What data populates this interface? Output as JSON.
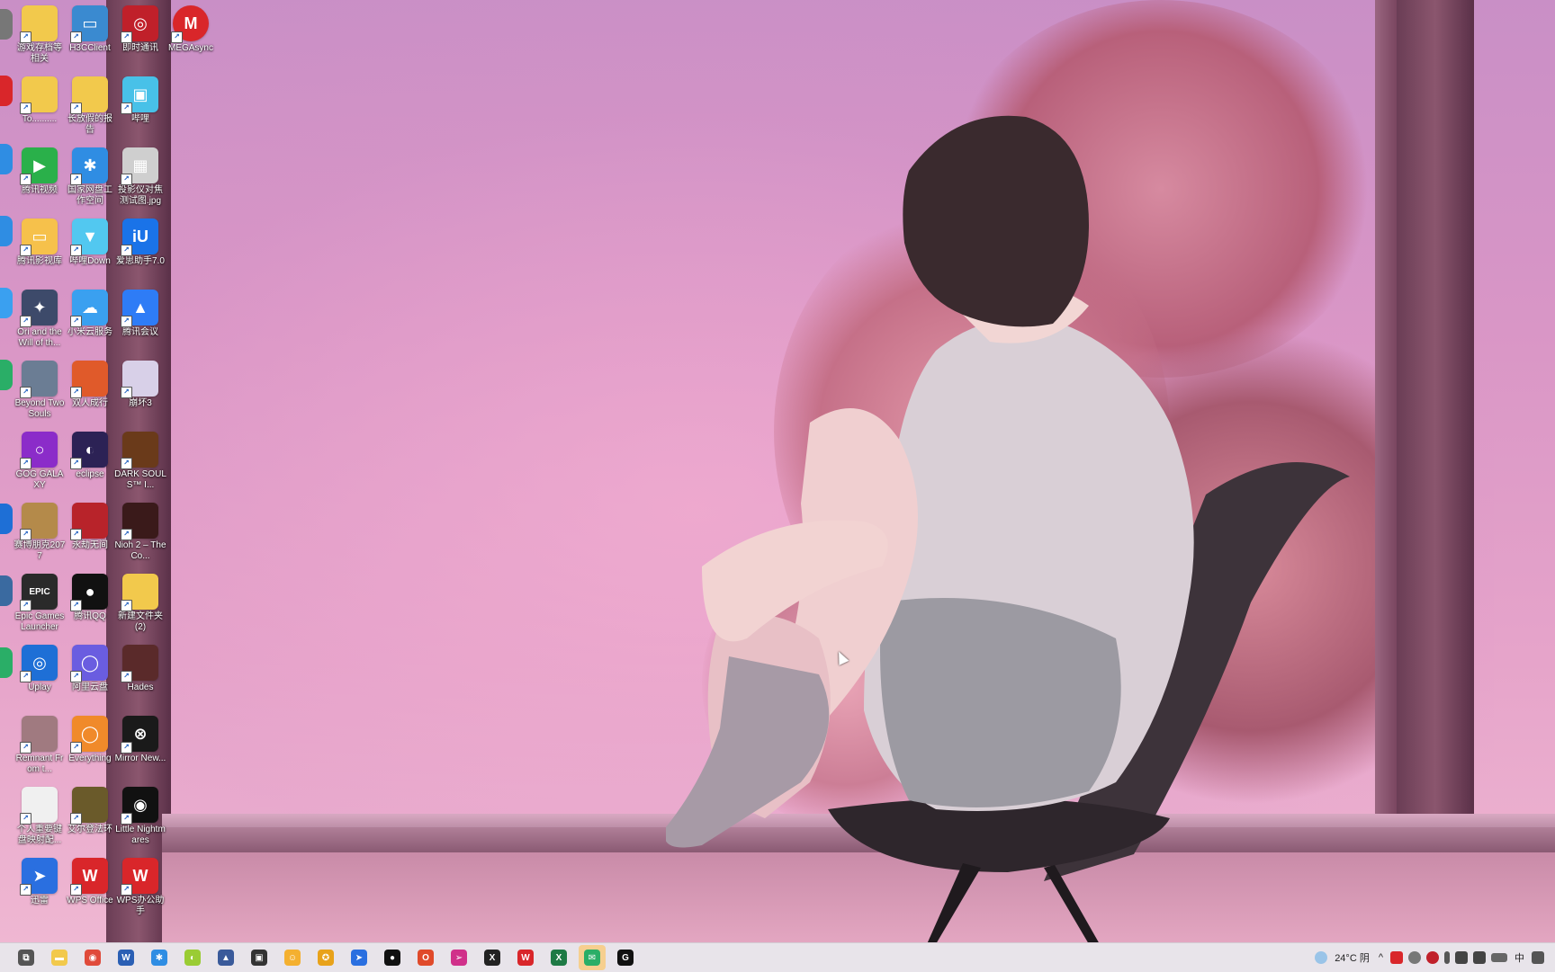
{
  "desktop": {
    "columns": [
      [
        {
          "label": "游戏存档等相关",
          "icon": "folder",
          "color": "#f2c94c"
        },
        {
          "label": "To..........",
          "icon": "folder",
          "color": "#f2c94c"
        },
        {
          "label": "腾讯视频",
          "icon": "play-icon",
          "color": "#2ab04a"
        },
        {
          "label": "腾讯影视库",
          "icon": "folder-tv",
          "color": "#f6c14b"
        },
        {
          "label": "Ori and the Will of th...",
          "icon": "ori-game",
          "color": "#3d4a6a"
        },
        {
          "label": "Beyond Two Souls",
          "icon": "game",
          "color": "#6b7d94"
        },
        {
          "label": "GOG GALAXY",
          "icon": "gog-ring",
          "color": "#8b2cc9"
        },
        {
          "label": "赛博朋克2077",
          "icon": "game",
          "color": "#b48a4a"
        },
        {
          "label": "Epic Games Launcher",
          "icon": "epic",
          "color": "#2a2a2a"
        },
        {
          "label": "Uplay",
          "icon": "uplay",
          "color": "#1e6fd6"
        },
        {
          "label": "Remnant From t...",
          "icon": "game",
          "color": "#a07a80"
        },
        {
          "label": "个人重要键盘映射配...",
          "icon": "document",
          "color": "#f0f0f0"
        },
        {
          "label": "迅雷",
          "icon": "thunder",
          "color": "#2a6fe0"
        }
      ],
      [
        {
          "label": "H3CClient",
          "icon": "h3c",
          "color": "#3a8ad0"
        },
        {
          "label": "长放假的报告",
          "icon": "folder",
          "color": "#f2c94c"
        },
        {
          "label": "国家网盘工作空间",
          "icon": "netdisk",
          "color": "#2f8de3"
        },
        {
          "label": "哔哩Down",
          "icon": "bili-down",
          "color": "#52c8f0"
        },
        {
          "label": "小米云服务",
          "icon": "cloud",
          "color": "#3aa0f0"
        },
        {
          "label": "双人成行",
          "icon": "game",
          "color": "#e05a2a"
        },
        {
          "label": "eclipse",
          "icon": "eclipse",
          "color": "#2c2255"
        },
        {
          "label": "永劫无间",
          "icon": "game",
          "color": "#b8232a"
        },
        {
          "label": "腾讯QQ",
          "icon": "qq-penguin",
          "color": "#111111"
        },
        {
          "label": "阿里云盘",
          "icon": "aliyun",
          "color": "#6a5de0"
        },
        {
          "label": "Everything",
          "icon": "search-ring",
          "color": "#f08a2a"
        },
        {
          "label": "艾尔登法环",
          "icon": "game",
          "color": "#6a5a2a"
        },
        {
          "label": "WPS Office",
          "icon": "wps",
          "color": "#d9262a"
        }
      ],
      [
        {
          "label": "即时通讯",
          "icon": "chat",
          "color": "#c0202a"
        },
        {
          "label": "哔哩",
          "icon": "bilibili",
          "color": "#48c1e8"
        },
        {
          "label": "投影仪对焦测试图.jpg",
          "icon": "image",
          "color": "#cfcfcf"
        },
        {
          "label": "爱思助手7.0",
          "icon": "iu",
          "color": "#1a73e8"
        },
        {
          "label": "腾讯会议",
          "icon": "meeting",
          "color": "#2e7cf6"
        },
        {
          "label": "崩坏3",
          "icon": "game",
          "color": "#d8d0e8"
        },
        {
          "label": "DARK SOULS™ I...",
          "icon": "game",
          "color": "#6a3a1a"
        },
        {
          "label": "Nioh 2 – The Co...",
          "icon": "game",
          "color": "#3a1a1a"
        },
        {
          "label": "新建文件夹 (2)",
          "icon": "folder",
          "color": "#f2c94c"
        },
        {
          "label": "Hades",
          "icon": "game",
          "color": "#5a2a2a"
        },
        {
          "label": "Mirror New...",
          "icon": "mirror",
          "color": "#1a1a1a"
        },
        {
          "label": "Little Nightmares",
          "icon": "eye",
          "color": "#111111"
        },
        {
          "label": "WPS办公助手",
          "icon": "wps-cloud",
          "color": "#d9262a"
        }
      ],
      [
        {
          "label": "MEGAsync",
          "icon": "mega",
          "color": "#d9262a"
        }
      ]
    ]
  },
  "taskbar": {
    "apps": [
      {
        "name": "task-view",
        "color": "#555555",
        "glyph": "⧉"
      },
      {
        "name": "file-explorer",
        "color": "#f2c94c",
        "glyph": "▬"
      },
      {
        "name": "chrome",
        "color": "#e04a3a",
        "glyph": "◉"
      },
      {
        "name": "word",
        "color": "#2b5fb4",
        "glyph": "W"
      },
      {
        "name": "netdisk",
        "color": "#2f8de3",
        "glyph": "✱"
      },
      {
        "name": "wechat-green",
        "color": "#9acc34",
        "glyph": "◐"
      },
      {
        "name": "tool",
        "color": "#3a5a9a",
        "glyph": "▲"
      },
      {
        "name": "notes",
        "color": "#333333",
        "glyph": "▣"
      },
      {
        "name": "emoji-app",
        "color": "#f4b030",
        "glyph": "☺"
      },
      {
        "name": "game-app",
        "color": "#e8a21a",
        "glyph": "✪"
      },
      {
        "name": "thunder",
        "color": "#2a6fe0",
        "glyph": "➤"
      },
      {
        "name": "qq",
        "color": "#111111",
        "glyph": "●"
      },
      {
        "name": "office",
        "color": "#e04a2a",
        "glyph": "O"
      },
      {
        "name": "send-app",
        "color": "#d0308a",
        "glyph": "➢"
      },
      {
        "name": "xbox",
        "color": "#222222",
        "glyph": "X"
      },
      {
        "name": "wps",
        "color": "#d9262a",
        "glyph": "W"
      },
      {
        "name": "excel",
        "color": "#1e7a45",
        "glyph": "X"
      },
      {
        "name": "wechat",
        "color": "#2aae67",
        "glyph": "✉"
      },
      {
        "name": "g-app",
        "color": "#111111",
        "glyph": "G"
      }
    ],
    "weather": "24°C 阴",
    "ime": "中"
  }
}
